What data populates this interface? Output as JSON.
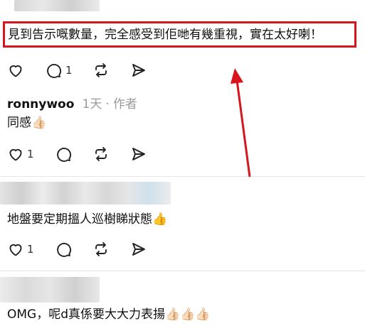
{
  "comments": [
    {
      "text": "見到告示嘅數量，完全感受到佢哋有幾重視，實在太好喇！",
      "replies_count": "1"
    },
    {
      "author": "ronnywoo",
      "time": "1天",
      "separator": "·",
      "role": "作者",
      "text": "同感👍🏻",
      "likes_count": "1"
    },
    {
      "text": "地盤要定期搵人巡樹睇狀態👍",
      "likes_count": "1"
    },
    {
      "text": "OMG，呢d真係要大大力表揚👍🏻👍🏻👍🏻"
    }
  ],
  "annotation": {
    "box_color": "#d8141c",
    "arrow_color": "#d8141c"
  },
  "icons": [
    "heart-icon",
    "comment-icon",
    "repost-icon",
    "share-icon"
  ]
}
